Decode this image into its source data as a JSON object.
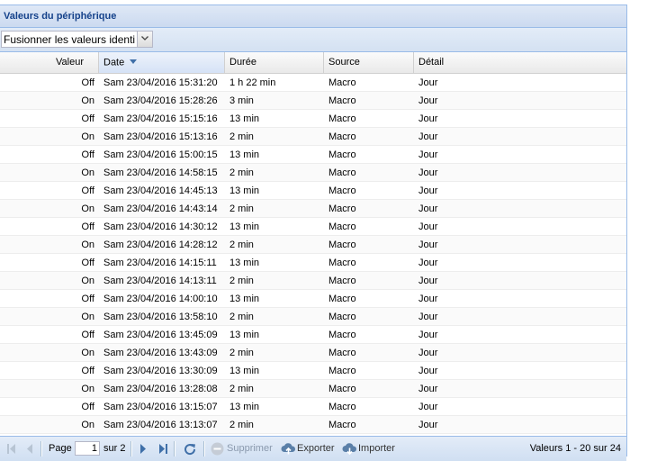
{
  "panel": {
    "title": "Valeurs du périphérique"
  },
  "toolbar": {
    "combo_value": "Fusionner les valeurs identi"
  },
  "columns": {
    "valeur": "Valeur",
    "date": "Date",
    "duree": "Durée",
    "source": "Source",
    "detail": "Détail"
  },
  "rows": [
    {
      "valeur": "Off",
      "date": "Sam 23/04/2016 15:31:20",
      "duree": "1 h 22 min",
      "source": "Macro",
      "detail": "Jour"
    },
    {
      "valeur": "On",
      "date": "Sam 23/04/2016 15:28:26",
      "duree": "3 min",
      "source": "Macro",
      "detail": "Jour"
    },
    {
      "valeur": "Off",
      "date": "Sam 23/04/2016 15:15:16",
      "duree": "13 min",
      "source": "Macro",
      "detail": "Jour"
    },
    {
      "valeur": "On",
      "date": "Sam 23/04/2016 15:13:16",
      "duree": "2 min",
      "source": "Macro",
      "detail": "Jour"
    },
    {
      "valeur": "Off",
      "date": "Sam 23/04/2016 15:00:15",
      "duree": "13 min",
      "source": "Macro",
      "detail": "Jour"
    },
    {
      "valeur": "On",
      "date": "Sam 23/04/2016 14:58:15",
      "duree": "2 min",
      "source": "Macro",
      "detail": "Jour"
    },
    {
      "valeur": "Off",
      "date": "Sam 23/04/2016 14:45:13",
      "duree": "13 min",
      "source": "Macro",
      "detail": "Jour"
    },
    {
      "valeur": "On",
      "date": "Sam 23/04/2016 14:43:14",
      "duree": "2 min",
      "source": "Macro",
      "detail": "Jour"
    },
    {
      "valeur": "Off",
      "date": "Sam 23/04/2016 14:30:12",
      "duree": "13 min",
      "source": "Macro",
      "detail": "Jour"
    },
    {
      "valeur": "On",
      "date": "Sam 23/04/2016 14:28:12",
      "duree": "2 min",
      "source": "Macro",
      "detail": "Jour"
    },
    {
      "valeur": "Off",
      "date": "Sam 23/04/2016 14:15:11",
      "duree": "13 min",
      "source": "Macro",
      "detail": "Jour"
    },
    {
      "valeur": "On",
      "date": "Sam 23/04/2016 14:13:11",
      "duree": "2 min",
      "source": "Macro",
      "detail": "Jour"
    },
    {
      "valeur": "Off",
      "date": "Sam 23/04/2016 14:00:10",
      "duree": "13 min",
      "source": "Macro",
      "detail": "Jour"
    },
    {
      "valeur": "On",
      "date": "Sam 23/04/2016 13:58:10",
      "duree": "2 min",
      "source": "Macro",
      "detail": "Jour"
    },
    {
      "valeur": "Off",
      "date": "Sam 23/04/2016 13:45:09",
      "duree": "13 min",
      "source": "Macro",
      "detail": "Jour"
    },
    {
      "valeur": "On",
      "date": "Sam 23/04/2016 13:43:09",
      "duree": "2 min",
      "source": "Macro",
      "detail": "Jour"
    },
    {
      "valeur": "Off",
      "date": "Sam 23/04/2016 13:30:09",
      "duree": "13 min",
      "source": "Macro",
      "detail": "Jour"
    },
    {
      "valeur": "On",
      "date": "Sam 23/04/2016 13:28:08",
      "duree": "2 min",
      "source": "Macro",
      "detail": "Jour"
    },
    {
      "valeur": "Off",
      "date": "Sam 23/04/2016 13:15:07",
      "duree": "13 min",
      "source": "Macro",
      "detail": "Jour"
    },
    {
      "valeur": "On",
      "date": "Sam 23/04/2016 13:13:07",
      "duree": "2 min",
      "source": "Macro",
      "detail": "Jour"
    }
  ],
  "pager": {
    "page_label": "Page",
    "page_value": "1",
    "of_label": "sur 2",
    "delete_label": "Supprimer",
    "export_label": "Exporter",
    "import_label": "Importer",
    "summary": "Valeurs 1 - 20 sur 24"
  },
  "icons": {
    "first": "first-page-icon",
    "prev": "prev-page-icon",
    "next": "next-page-icon",
    "last": "last-page-icon",
    "refresh": "refresh-icon",
    "delete": "minus-circle-icon",
    "export": "cloud-export-icon",
    "import": "cloud-import-icon",
    "sort": "sort-desc-icon",
    "combo": "chevron-down-icon"
  },
  "colors": {
    "header_text": "#15428b",
    "border": "#99bbe8",
    "icon_blue": "#3f6fa8"
  }
}
